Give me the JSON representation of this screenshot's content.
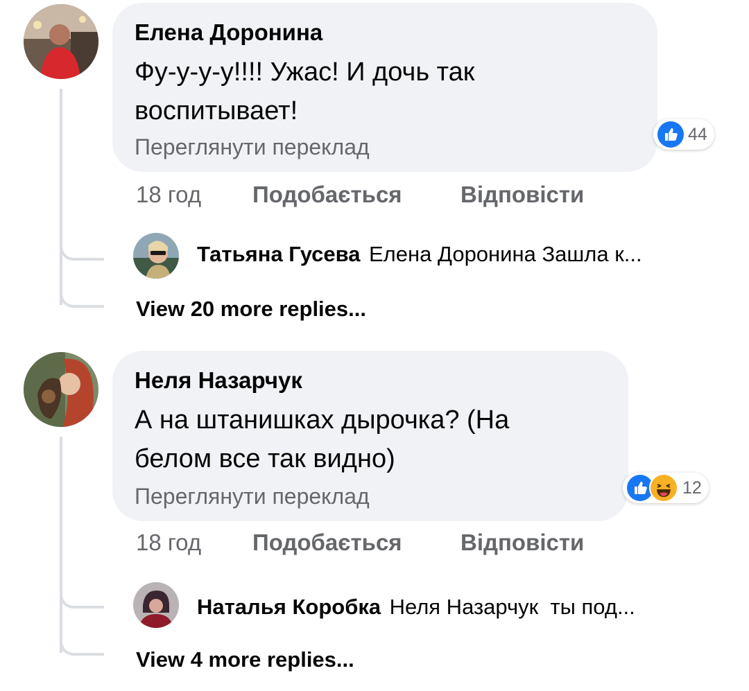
{
  "comments": [
    {
      "author": "Елена Доронина",
      "text_line1": "Фу-у-у-у!!!! Ужас! И дочь так",
      "text_line2": "воспитывает!",
      "translate": "Переглянути переклад",
      "reaction_count": "44",
      "reactions": [
        "like-icon"
      ],
      "time": "18 год",
      "like_label": "Подобається",
      "reply_label": "Відповісти",
      "reply": {
        "author": "Татьяна Гусева",
        "text": "Елена Доронина Зашла к..."
      },
      "view_more": "View 20 more replies..."
    },
    {
      "author": "Неля Назарчук",
      "text_line1": "А на штанишках дырочка? (На",
      "text_line2": "белом все так видно)",
      "translate": "Переглянути переклад",
      "reaction_count": "12",
      "reactions": [
        "like-icon",
        "haha-icon"
      ],
      "time": "18 год",
      "like_label": "Подобається",
      "reply_label": "Відповісти",
      "reply": {
        "author": "Наталья Коробка",
        "text": "Неля Назарчук  ты под..."
      },
      "view_more": "View 4 more replies..."
    }
  ],
  "colors": {
    "like": "#1877f2",
    "haha": "#f7b125",
    "secondary": "#65676b",
    "bubble": "#f0f2f5"
  }
}
